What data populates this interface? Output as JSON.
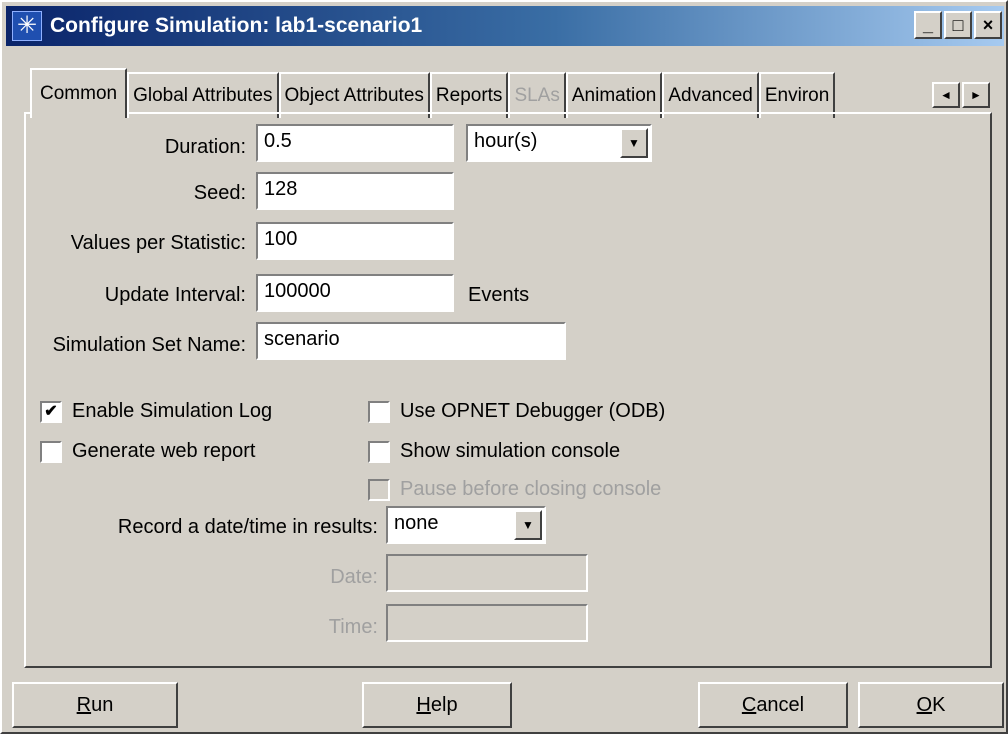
{
  "window": {
    "title": "Configure Simulation: lab1-scenario1",
    "icon": "asterisk-icon",
    "controls": {
      "minimize": "_",
      "maximize": "□",
      "close": "×"
    }
  },
  "tabs": [
    {
      "label": "Common",
      "active": true
    },
    {
      "label": "Global Attributes"
    },
    {
      "label": "Object Attributes"
    },
    {
      "label": "Reports"
    },
    {
      "label": "SLAs",
      "disabled": true
    },
    {
      "label": "Animation"
    },
    {
      "label": "Advanced"
    },
    {
      "label": "Environ"
    }
  ],
  "tab_scroll": {
    "left": "◄",
    "right": "►"
  },
  "form": {
    "duration_label": "Duration:",
    "duration_value": "0.5",
    "duration_unit": "hour(s)",
    "seed_label": "Seed:",
    "seed_value": "128",
    "values_label": "Values per Statistic:",
    "values_value": "100",
    "update_label": "Update Interval:",
    "update_value": "100000",
    "update_unit": "Events",
    "setname_label": "Simulation Set Name:",
    "setname_value": "scenario"
  },
  "options": {
    "enable_log": {
      "label": "Enable Simulation Log",
      "checked": true,
      "mark": "✔"
    },
    "web_report": {
      "label": "Generate web report",
      "checked": false
    },
    "debugger": {
      "label": "Use OPNET Debugger (ODB)",
      "checked": false
    },
    "console": {
      "label": "Show simulation console",
      "checked": false
    },
    "pause": {
      "label": "Pause before closing console",
      "checked": false,
      "disabled": true
    }
  },
  "record": {
    "label": "Record a date/time in results:",
    "value": "none",
    "date_label": "Date:",
    "date_value": "",
    "time_label": "Time:",
    "time_value": ""
  },
  "buttons": {
    "run_mnemonic": "R",
    "run_rest": "un",
    "help_mnemonic": "H",
    "help_rest": "elp",
    "cancel_mnemonic": "C",
    "cancel_rest": "ancel",
    "ok_mnemonic": "O",
    "ok_rest": "K"
  },
  "colors": {
    "face": "#d4d0c8",
    "title_start": "#0a246a",
    "title_end": "#a6caf0",
    "disabled_text": "#a0a0a0"
  }
}
